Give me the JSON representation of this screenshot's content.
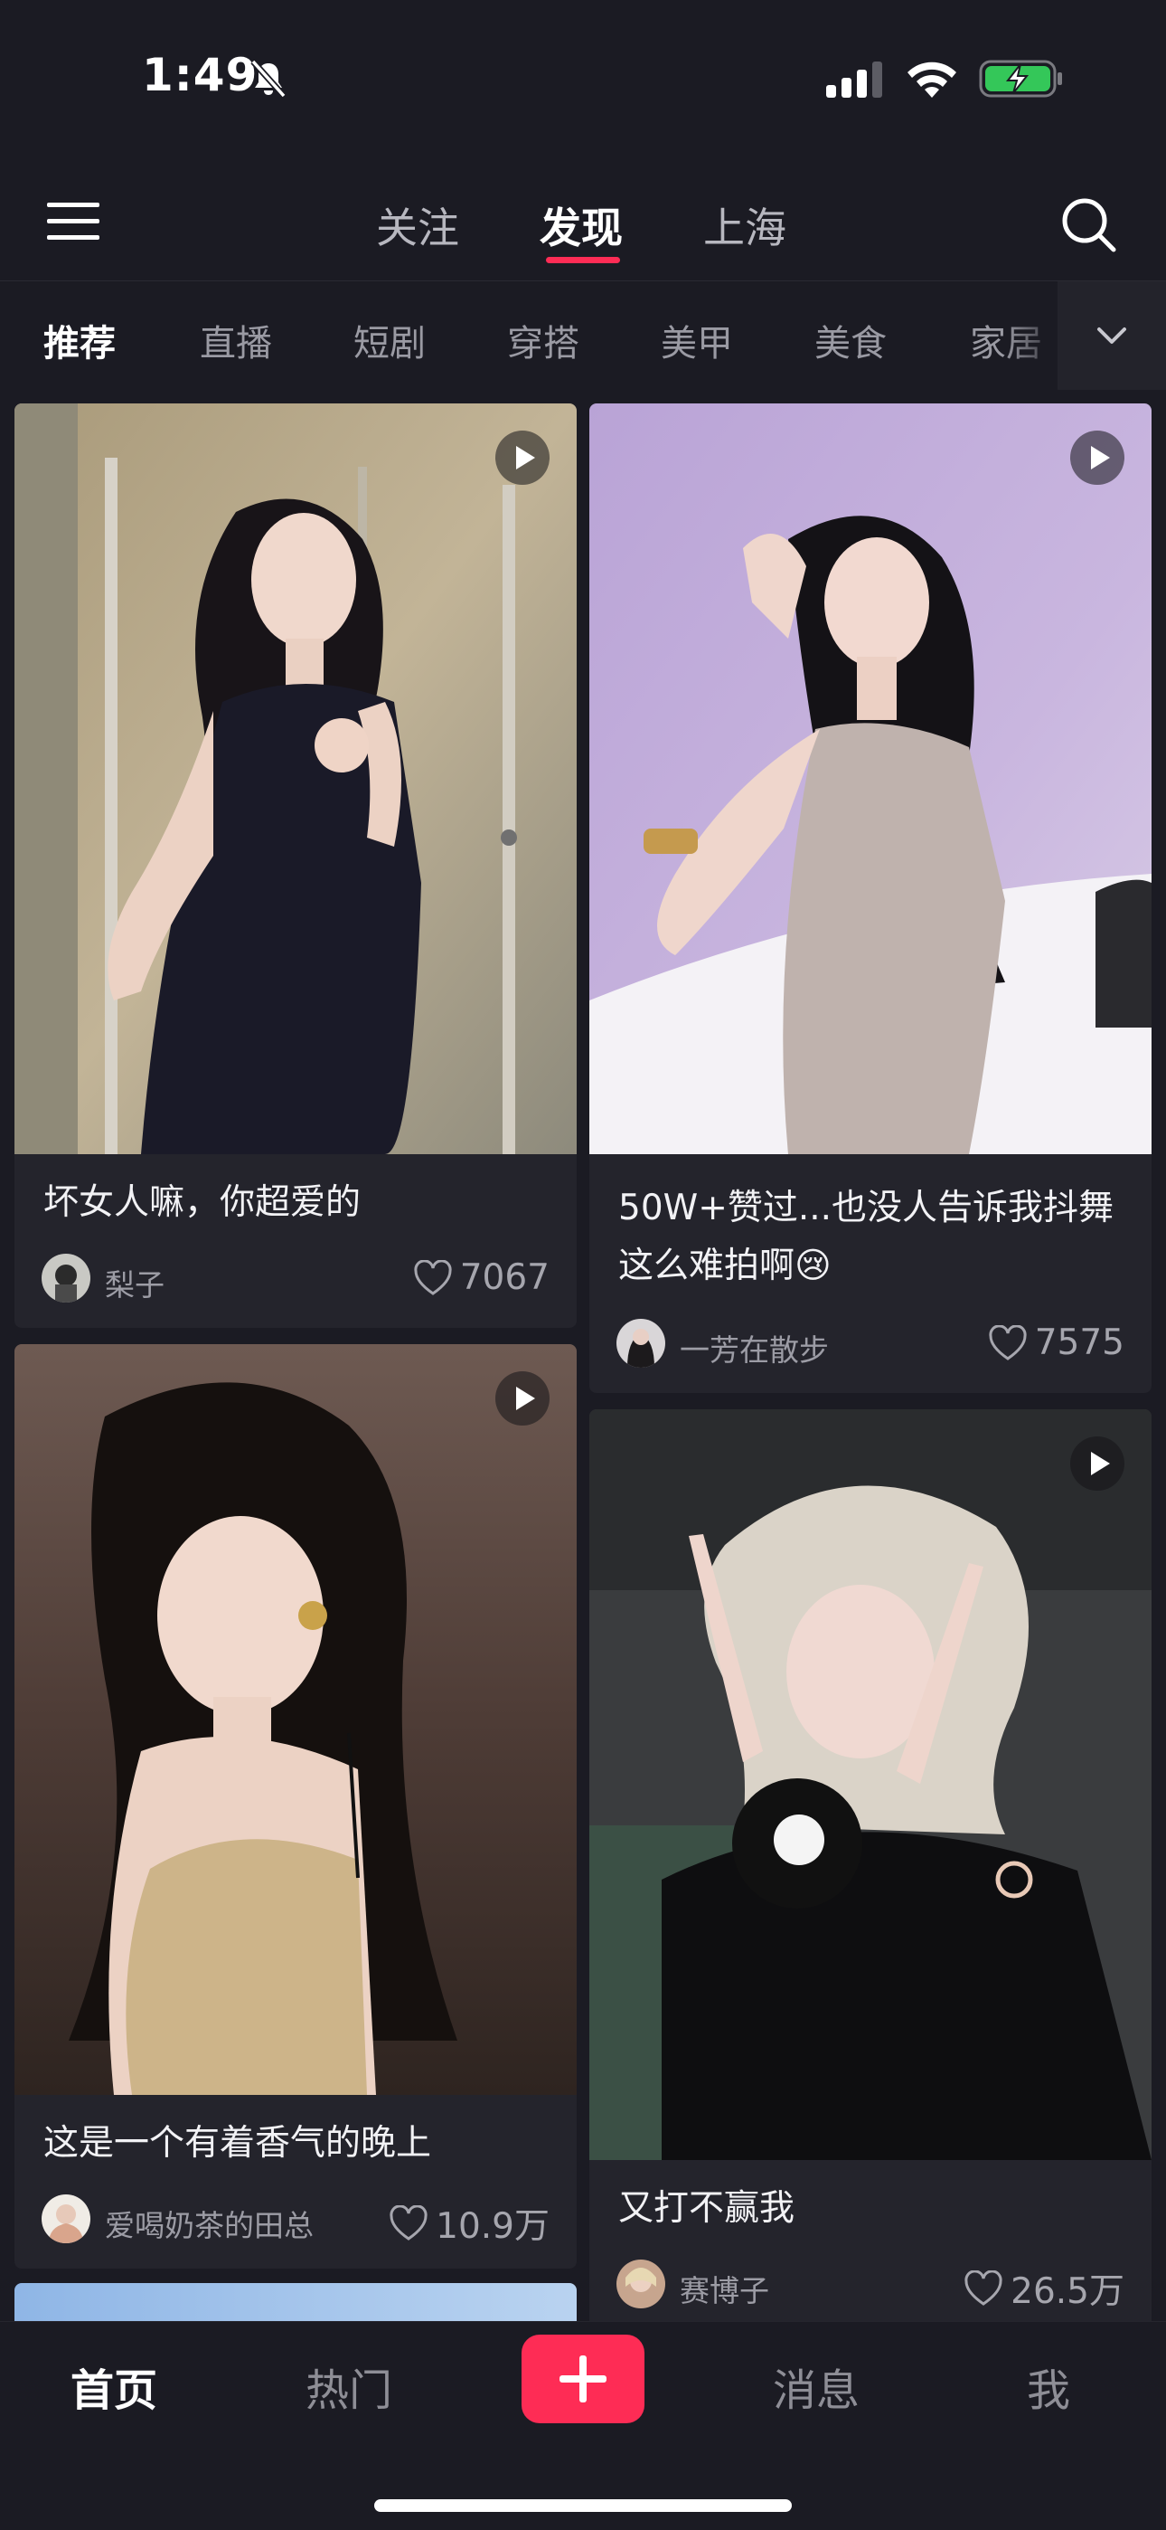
{
  "status_bar": {
    "time": "1:49"
  },
  "top_nav": {
    "tabs": [
      {
        "label": "关注"
      },
      {
        "label": "发现"
      },
      {
        "label": "上海"
      }
    ],
    "active_tab": "发现"
  },
  "categories": {
    "items": [
      "推荐",
      "直播",
      "短剧",
      "穿搭",
      "美甲",
      "美食",
      "家居"
    ],
    "active": "推荐"
  },
  "feed": {
    "cards": [
      {
        "title": "坏女人嘛，你超爱的",
        "author": "梨子",
        "likes": "7067",
        "is_video": true
      },
      {
        "title": "50W+赞过...也没人告诉我抖舞这么难拍啊😢",
        "author": "一芳在散步",
        "likes": "7575",
        "is_video": true
      },
      {
        "title": "这是一个有着香气的晚上",
        "author": "爱喝奶茶的田总",
        "likes": "10.9万",
        "is_video": true
      },
      {
        "title": "又打不赢我",
        "author": "赛博子",
        "likes": "26.5万",
        "is_video": true
      }
    ]
  },
  "tab_bar": {
    "items": [
      {
        "label": "首页"
      },
      {
        "label": "热门"
      },
      {
        "label": "消息"
      },
      {
        "label": "我"
      }
    ],
    "active": "首页"
  },
  "colors": {
    "accent": "#fe2c55",
    "background": "#1b1b23",
    "card": "#24242c"
  },
  "icons": [
    "bell-off-icon",
    "signal-icon",
    "wifi-icon",
    "battery-charging-icon",
    "menu-icon",
    "search-icon",
    "chevron-down-icon",
    "play-icon",
    "heart-icon",
    "plus-icon"
  ]
}
